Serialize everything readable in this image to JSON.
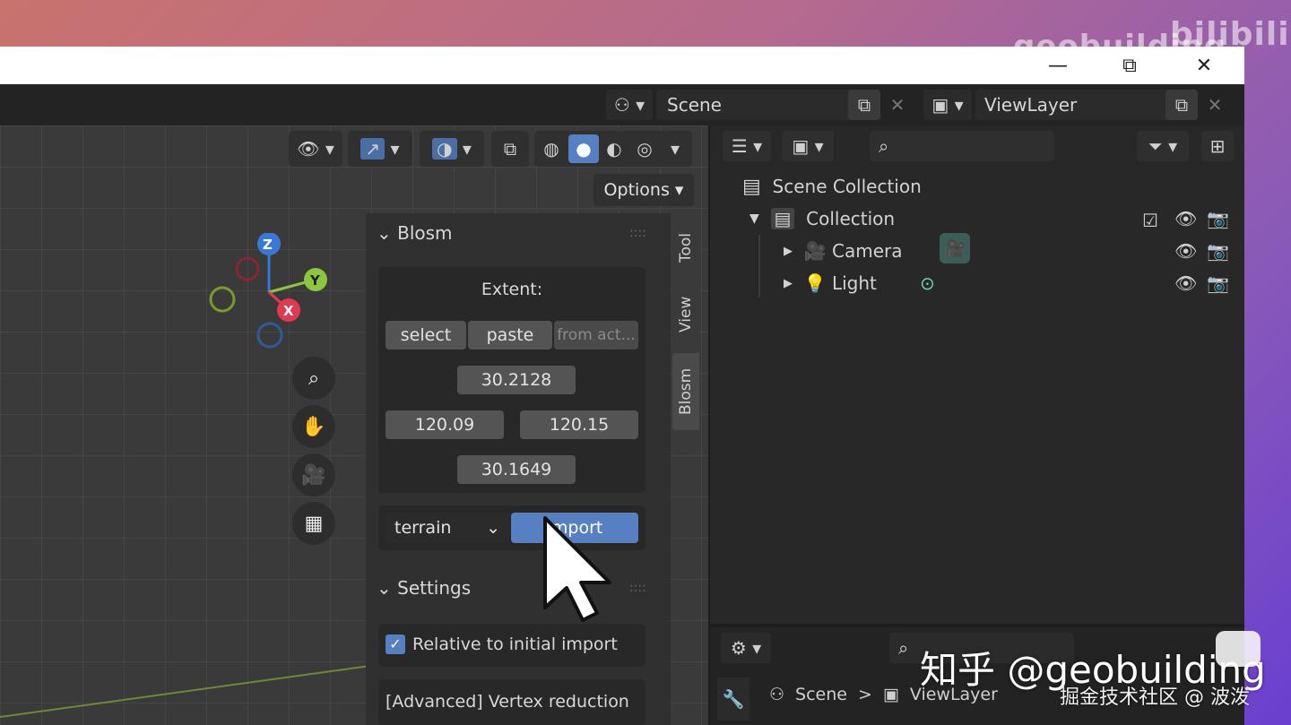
{
  "brand": "geobuilding",
  "brand_logo": "bilibili",
  "window_controls": {
    "minimize": "—",
    "maximize": "⧉",
    "close": "✕"
  },
  "topbar": {
    "scene": "Scene",
    "view_layer": "ViewLayer"
  },
  "viewport": {
    "options_label": "Options",
    "gizmo": {
      "z": "Z",
      "y": "Y",
      "x": "X"
    }
  },
  "blosm": {
    "section_title": "Blosm",
    "extent_label": "Extent:",
    "select_label": "select",
    "paste_label": "paste",
    "from_active_label": "from act...",
    "north": "30.2128",
    "west": "120.09",
    "east": "120.15",
    "south": "30.1649",
    "mode_value": "terrain",
    "import_label": "import"
  },
  "settings": {
    "section_title": "Settings",
    "relative_label": "Relative to initial import",
    "vertex_label": "[Advanced] Vertex reduction"
  },
  "side_tabs": {
    "tool": "Tool",
    "view": "View",
    "blosm": "Blosm"
  },
  "outliner": {
    "scene_collection": "Scene Collection",
    "collection": "Collection",
    "items": [
      {
        "label": "Camera"
      },
      {
        "label": "Light"
      }
    ]
  },
  "properties": {
    "breadcrumb_scene": "Scene",
    "breadcrumb_sep": ">",
    "breadcrumb_layer": "ViewLayer"
  },
  "watermark": {
    "zhihu": "知乎 @geobuilding",
    "juejin": "掘金技术社区 @ 波泼"
  },
  "colors": {
    "accent": "#5680c2",
    "gizmo_x": "#e03a50",
    "gizmo_y": "#8cc63f",
    "gizmo_z": "#3a78d8"
  }
}
